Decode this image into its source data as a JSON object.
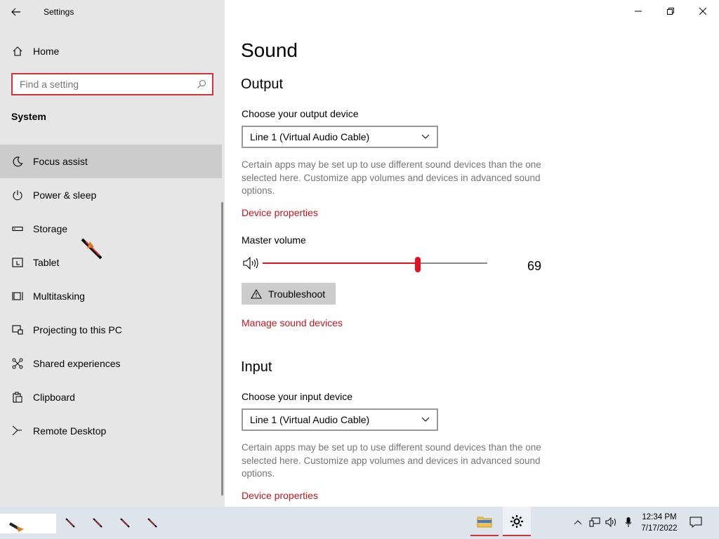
{
  "window": {
    "title": "Settings"
  },
  "sidebar": {
    "home_label": "Home",
    "search_placeholder": "Find a setting",
    "section_title": "System",
    "items": [
      {
        "label": "Focus assist",
        "icon": "moon-icon",
        "active": true
      },
      {
        "label": "Power & sleep",
        "icon": "power-icon"
      },
      {
        "label": "Storage",
        "icon": "storage-icon"
      },
      {
        "label": "Tablet",
        "icon": "tablet-icon"
      },
      {
        "label": "Multitasking",
        "icon": "multitasking-icon"
      },
      {
        "label": "Projecting to this PC",
        "icon": "projecting-icon"
      },
      {
        "label": "Shared experiences",
        "icon": "shared-experiences-icon"
      },
      {
        "label": "Clipboard",
        "icon": "clipboard-icon"
      },
      {
        "label": "Remote Desktop",
        "icon": "remote-desktop-icon"
      }
    ]
  },
  "main": {
    "title": "Sound",
    "output": {
      "heading": "Output",
      "device_label": "Choose your output device",
      "device_value": "Line 1 (Virtual Audio Cable)",
      "description": "Certain apps may be set up to use different sound devices than the one selected here. Customize app volumes and devices in advanced sound options.",
      "device_properties_link": "Device properties",
      "master_volume_label": "Master volume",
      "volume_value": "69",
      "volume_level": 0.69,
      "troubleshoot_label": "Troubleshoot",
      "manage_devices_link": "Manage sound devices"
    },
    "input": {
      "heading": "Input",
      "device_label": "Choose your input device",
      "device_value": "Line 1 (Virtual Audio Cable)",
      "description": "Certain apps may be set up to use different sound devices than the one selected here. Customize app volumes and devices in advanced sound options.",
      "device_properties_link": "Device properties"
    }
  },
  "taskbar": {
    "time": "12:34 PM",
    "date": "7/17/2022"
  },
  "colors": {
    "accent": "#e81123",
    "link": "#c4151c",
    "sidebar_bg": "#e6e6e6",
    "active_item_bg": "#cccccc"
  }
}
